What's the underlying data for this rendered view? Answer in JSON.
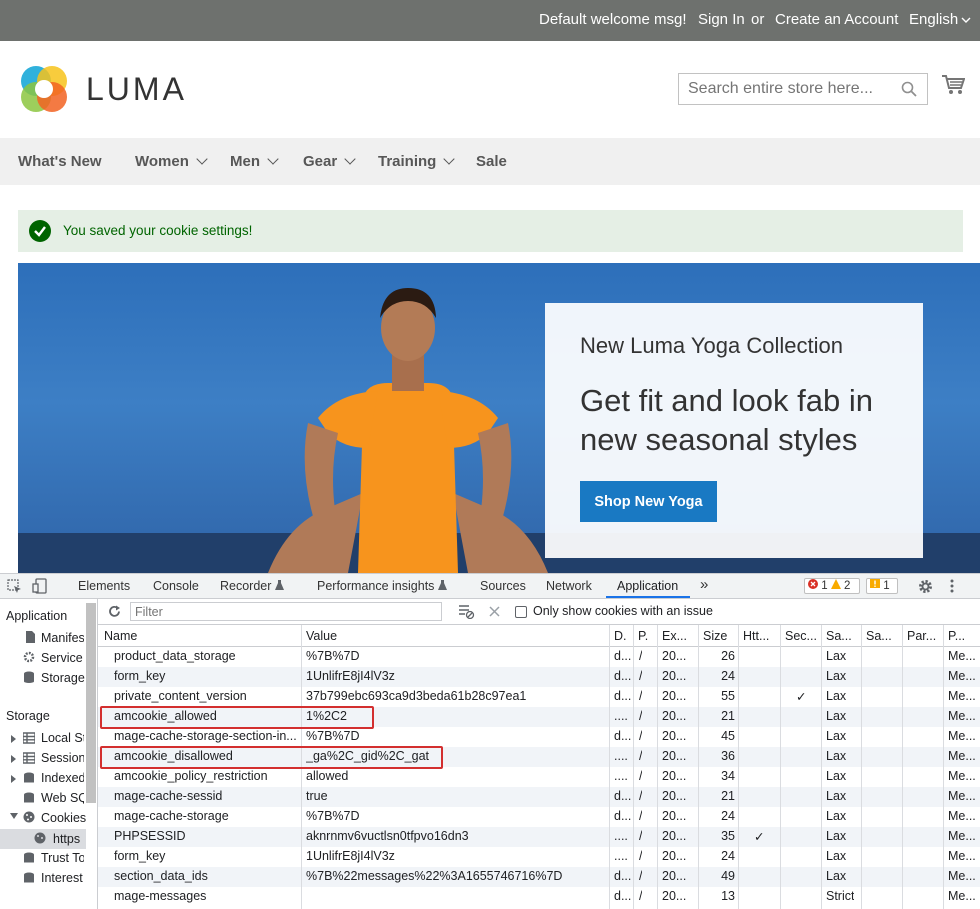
{
  "topbar": {
    "welcome": "Default welcome msg!",
    "sign_in": "Sign In",
    "or": "or",
    "create_account": "Create an Account",
    "language": "English"
  },
  "header": {
    "logo_text": "LUMA",
    "search_placeholder": "Search entire store here..."
  },
  "nav": {
    "items": [
      "What's New",
      "Women",
      "Men",
      "Gear",
      "Training",
      "Sale"
    ]
  },
  "message": {
    "text": "You saved your cookie settings!"
  },
  "hero": {
    "title": "New Luma Yoga Collection",
    "headline": "Get fit and look fab in new seasonal styles",
    "button": "Shop New Yoga"
  },
  "devtools": {
    "tabs": [
      "Elements",
      "Console",
      "Recorder",
      "Performance insights",
      "Sources",
      "Network",
      "Application"
    ],
    "more": "»",
    "errors": "1",
    "warnings": "2",
    "issues": "1",
    "filter_placeholder": "Filter",
    "only_issues_label": "Only show cookies with an issue",
    "sidebar": {
      "application_header": "Application",
      "app_items": [
        "Manifest",
        "Service",
        "Storage"
      ],
      "storage_header": "Storage",
      "storage_items": [
        "Local Storage",
        "Session Storage",
        "IndexedDB",
        "Web SQL",
        "Cookies",
        "https",
        "Trust Tokens",
        "Interest Groups"
      ]
    },
    "columns": [
      "Name",
      "Value",
      "D.",
      "P.",
      "Ex...",
      "Size",
      "Htt...",
      "Sec...",
      "Sa...",
      "Sa...",
      "Par...",
      "P..."
    ],
    "rows": [
      {
        "name": "product_data_storage",
        "value": "%7B%7D",
        "d": "d...",
        "p": "/",
        "ex": "20...",
        "size": "26",
        "http": "",
        "sec": "",
        "same": "Lax",
        "p2": "Me..."
      },
      {
        "name": "form_key",
        "value": "1UnlifrE8jI4lV3z",
        "d": "d...",
        "p": "/",
        "ex": "20...",
        "size": "24",
        "http": "",
        "sec": "",
        "same": "Lax",
        "p2": "Me..."
      },
      {
        "name": "private_content_version",
        "value": "37b799ebc693ca9d3beda61b28c97ea1",
        "d": "d...",
        "p": "/",
        "ex": "20...",
        "size": "55",
        "http": "",
        "sec": "✓",
        "same": "Lax",
        "p2": "Me..."
      },
      {
        "name": "amcookie_allowed",
        "value": "1%2C2",
        "d": "....",
        "p": "/",
        "ex": "20...",
        "size": "21",
        "http": "",
        "sec": "",
        "same": "Lax",
        "p2": "Me..."
      },
      {
        "name": "mage-cache-storage-section-in...",
        "value": "%7B%7D",
        "d": "d...",
        "p": "/",
        "ex": "20...",
        "size": "45",
        "http": "",
        "sec": "",
        "same": "Lax",
        "p2": "Me..."
      },
      {
        "name": "amcookie_disallowed",
        "value": "_ga%2C_gid%2C_gat",
        "d": "....",
        "p": "/",
        "ex": "20...",
        "size": "36",
        "http": "",
        "sec": "",
        "same": "Lax",
        "p2": "Me..."
      },
      {
        "name": "amcookie_policy_restriction",
        "value": "allowed",
        "d": "....",
        "p": "/",
        "ex": "20...",
        "size": "34",
        "http": "",
        "sec": "",
        "same": "Lax",
        "p2": "Me..."
      },
      {
        "name": "mage-cache-sessid",
        "value": "true",
        "d": "d...",
        "p": "/",
        "ex": "20...",
        "size": "21",
        "http": "",
        "sec": "",
        "same": "Lax",
        "p2": "Me..."
      },
      {
        "name": "mage-cache-storage",
        "value": "%7B%7D",
        "d": "d...",
        "p": "/",
        "ex": "20...",
        "size": "24",
        "http": "",
        "sec": "",
        "same": "Lax",
        "p2": "Me..."
      },
      {
        "name": "PHPSESSID",
        "value": "aknrnmv6vuctlsn0tfpvo16dn3",
        "d": "....",
        "p": "/",
        "ex": "20...",
        "size": "35",
        "http": "✓",
        "sec": "",
        "same": "Lax",
        "p2": "Me..."
      },
      {
        "name": "form_key",
        "value": "1UnlifrE8jI4lV3z",
        "d": "....",
        "p": "/",
        "ex": "20...",
        "size": "24",
        "http": "",
        "sec": "",
        "same": "Lax",
        "p2": "Me..."
      },
      {
        "name": "section_data_ids",
        "value": "%7B%22messages%22%3A1655746716%7D",
        "d": "d...",
        "p": "/",
        "ex": "20...",
        "size": "49",
        "http": "",
        "sec": "",
        "same": "Lax",
        "p2": "Me..."
      },
      {
        "name": "mage-messages",
        "value": "",
        "d": "d...",
        "p": "/",
        "ex": "20...",
        "size": "13",
        "http": "",
        "sec": "",
        "same": "Strict",
        "p2": "Me..."
      }
    ]
  },
  "colors": {
    "topbar": "#6e716e",
    "link": "#1979c3",
    "success": "#006400",
    "highlight": "#d32f2f"
  }
}
